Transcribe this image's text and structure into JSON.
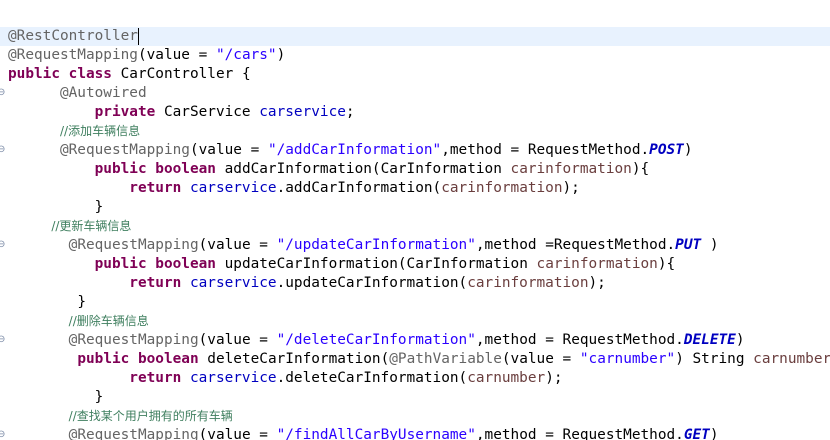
{
  "editor": {
    "fold_glyph": "⊖",
    "lines": [
      {
        "indent": "",
        "current": true,
        "tokens": [
          {
            "t": "annotation",
            "v": "@RestController"
          }
        ]
      },
      {
        "indent": "",
        "tokens": [
          {
            "t": "annotation",
            "v": "@RequestMapping"
          },
          {
            "t": "plain",
            "v": "(value = "
          },
          {
            "t": "string",
            "v": "\"/cars\""
          },
          {
            "t": "plain",
            "v": ")"
          }
        ]
      },
      {
        "indent": "",
        "tokens": [
          {
            "t": "keyword",
            "v": "public"
          },
          {
            "t": "plain",
            "v": " "
          },
          {
            "t": "keyword",
            "v": "class"
          },
          {
            "t": "plain",
            "v": " CarController {"
          }
        ]
      },
      {
        "indent": "      ",
        "fold": true,
        "tokens": [
          {
            "t": "annotation",
            "v": "@Autowired"
          }
        ]
      },
      {
        "indent": "          ",
        "tokens": [
          {
            "t": "keyword",
            "v": "private"
          },
          {
            "t": "plain",
            "v": " CarService "
          },
          {
            "t": "field",
            "v": "carservice"
          },
          {
            "t": "plain",
            "v": ";"
          }
        ]
      },
      {
        "indent": "      ",
        "tokens": [
          {
            "t": "comment",
            "v": "//添加车辆信息"
          }
        ]
      },
      {
        "indent": "      ",
        "fold": true,
        "tokens": [
          {
            "t": "annotation",
            "v": "@RequestMapping"
          },
          {
            "t": "plain",
            "v": "(value = "
          },
          {
            "t": "string",
            "v": "\"/addCarInformation\""
          },
          {
            "t": "plain",
            "v": ",method = RequestMethod."
          },
          {
            "t": "const",
            "v": "POST"
          },
          {
            "t": "plain",
            "v": ")"
          }
        ]
      },
      {
        "indent": "          ",
        "tokens": [
          {
            "t": "keyword",
            "v": "public"
          },
          {
            "t": "plain",
            "v": " "
          },
          {
            "t": "keyword",
            "v": "boolean"
          },
          {
            "t": "plain",
            "v": " addCarInformation(CarInformation "
          },
          {
            "t": "param",
            "v": "carinformation"
          },
          {
            "t": "plain",
            "v": "){"
          }
        ]
      },
      {
        "indent": "              ",
        "tokens": [
          {
            "t": "keyword",
            "v": "return"
          },
          {
            "t": "plain",
            "v": " "
          },
          {
            "t": "field",
            "v": "carservice"
          },
          {
            "t": "plain",
            "v": ".addCarInformation("
          },
          {
            "t": "param",
            "v": "carinformation"
          },
          {
            "t": "plain",
            "v": ");"
          }
        ]
      },
      {
        "indent": "          ",
        "tokens": [
          {
            "t": "plain",
            "v": "}"
          }
        ]
      },
      {
        "indent": "     ",
        "tokens": [
          {
            "t": "comment",
            "v": "//更新车辆信息"
          }
        ]
      },
      {
        "indent": "       ",
        "fold": true,
        "tokens": [
          {
            "t": "annotation",
            "v": "@RequestMapping"
          },
          {
            "t": "plain",
            "v": "(value = "
          },
          {
            "t": "string",
            "v": "\"/updateCarInformation\""
          },
          {
            "t": "plain",
            "v": ",method =RequestMethod."
          },
          {
            "t": "const",
            "v": "PUT"
          },
          {
            "t": "plain",
            "v": " )"
          }
        ]
      },
      {
        "indent": "          ",
        "tokens": [
          {
            "t": "keyword",
            "v": "public"
          },
          {
            "t": "plain",
            "v": " "
          },
          {
            "t": "keyword",
            "v": "boolean"
          },
          {
            "t": "plain",
            "v": " updateCarInformation(CarInformation "
          },
          {
            "t": "param",
            "v": "carinformation"
          },
          {
            "t": "plain",
            "v": "){"
          }
        ]
      },
      {
        "indent": "              ",
        "tokens": [
          {
            "t": "keyword",
            "v": "return"
          },
          {
            "t": "plain",
            "v": " "
          },
          {
            "t": "field",
            "v": "carservice"
          },
          {
            "t": "plain",
            "v": ".updateCarInformation("
          },
          {
            "t": "param",
            "v": "carinformation"
          },
          {
            "t": "plain",
            "v": ");"
          }
        ]
      },
      {
        "indent": "       ",
        "tokens": [
          {
            "t": "plain",
            "v": " }"
          }
        ]
      },
      {
        "indent": "       ",
        "tokens": [
          {
            "t": "comment",
            "v": "//删除车辆信息"
          }
        ]
      },
      {
        "indent": "       ",
        "fold": true,
        "tokens": [
          {
            "t": "annotation",
            "v": "@RequestMapping"
          },
          {
            "t": "plain",
            "v": "(value = "
          },
          {
            "t": "string",
            "v": "\"/deleteCarInformation\""
          },
          {
            "t": "plain",
            "v": ",method = RequestMethod."
          },
          {
            "t": "const",
            "v": "DELETE"
          },
          {
            "t": "plain",
            "v": ")"
          }
        ]
      },
      {
        "indent": "       ",
        "tokens": [
          {
            "t": "plain",
            "v": " "
          },
          {
            "t": "keyword",
            "v": "public"
          },
          {
            "t": "plain",
            "v": " "
          },
          {
            "t": "keyword",
            "v": "boolean"
          },
          {
            "t": "plain",
            "v": " deleteCarInformation("
          },
          {
            "t": "annotation",
            "v": "@PathVariable"
          },
          {
            "t": "plain",
            "v": "(value = "
          },
          {
            "t": "string",
            "v": "\"carnumber\""
          },
          {
            "t": "plain",
            "v": ") String "
          },
          {
            "t": "param",
            "v": "carnumber"
          }
        ]
      },
      {
        "indent": "              ",
        "tokens": [
          {
            "t": "keyword",
            "v": "return"
          },
          {
            "t": "plain",
            "v": " "
          },
          {
            "t": "field",
            "v": "carservice"
          },
          {
            "t": "plain",
            "v": ".deleteCarInformation("
          },
          {
            "t": "param",
            "v": "carnumber"
          },
          {
            "t": "plain",
            "v": ");"
          }
        ]
      },
      {
        "indent": "          ",
        "tokens": [
          {
            "t": "plain",
            "v": "}"
          }
        ]
      },
      {
        "indent": "       ",
        "tokens": [
          {
            "t": "comment",
            "v": "//查找某个用户拥有的所有车辆"
          }
        ]
      },
      {
        "indent": "       ",
        "fold": true,
        "tokens": [
          {
            "t": "annotation",
            "v": "@RequestMapping"
          },
          {
            "t": "plain",
            "v": "(value = "
          },
          {
            "t": "string",
            "v": "\"/findAllCarByUsername\""
          },
          {
            "t": "plain",
            "v": ",method = RequestMethod."
          },
          {
            "t": "const",
            "v": "GET"
          },
          {
            "t": "plain",
            "v": ")"
          }
        ]
      }
    ]
  }
}
